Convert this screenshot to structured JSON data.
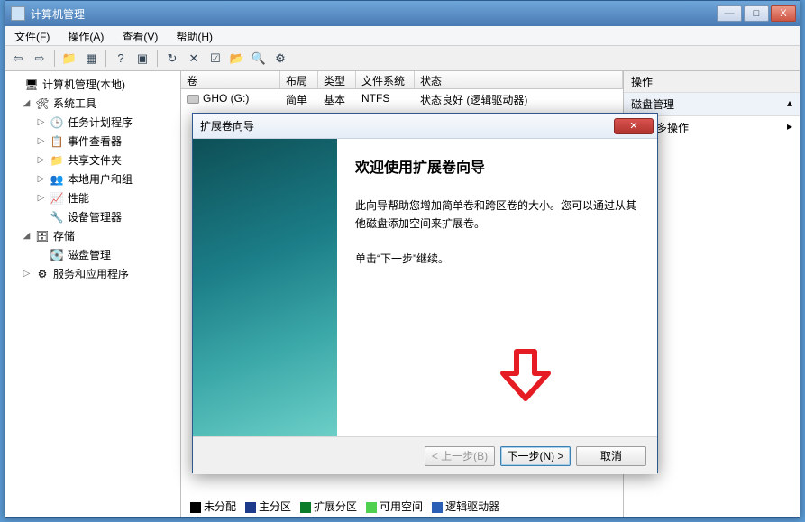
{
  "window": {
    "title": "计算机管理",
    "buttons": {
      "min": "—",
      "max": "□",
      "close": "X"
    }
  },
  "menu": {
    "file": "文件(F)",
    "action": "操作(A)",
    "view": "查看(V)",
    "help": "帮助(H)"
  },
  "tree": {
    "root": "计算机管理(本地)",
    "systools": "系统工具",
    "scheduler": "任务计划程序",
    "eventviewer": "事件查看器",
    "shared": "共享文件夹",
    "localusers": "本地用户和组",
    "perf": "性能",
    "devmgr": "设备管理器",
    "storage": "存储",
    "diskmgmt": "磁盘管理",
    "services": "服务和应用程序"
  },
  "list": {
    "headers": {
      "vol": "卷",
      "layout": "布局",
      "type": "类型",
      "fs": "文件系统",
      "status": "状态"
    },
    "rows": [
      {
        "vol": "GHO (G:)",
        "layout": "简单",
        "type": "基本",
        "fs": "NTFS",
        "status": "状态良好 (逻辑驱动器)"
      }
    ]
  },
  "legend": {
    "unalloc": "未分配",
    "primary": "主分区",
    "extended": "扩展分区",
    "free": "可用空间",
    "logical": "逻辑驱动器"
  },
  "actions": {
    "title": "操作",
    "section": "磁盘管理",
    "more": "更多操作"
  },
  "wizard": {
    "title": "扩展卷向导",
    "heading": "欢迎使用扩展卷向导",
    "para1": "此向导帮助您增加简单卷和跨区卷的大小。您可以通过从其他磁盘添加空间来扩展卷。",
    "para2": "单击“下一步”继续。",
    "back": "< 上一步(B)",
    "next": "下一步(N) >",
    "cancel": "取消"
  }
}
